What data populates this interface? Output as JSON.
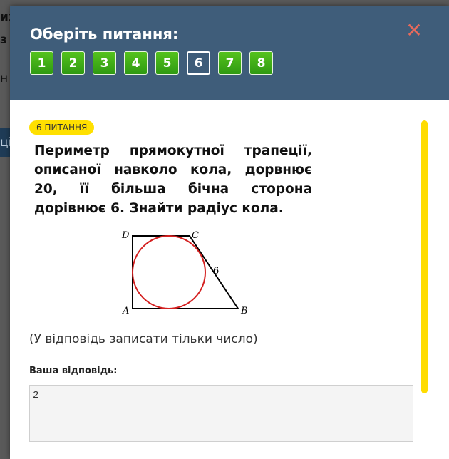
{
  "backdrop": {
    "line1": "их",
    "line2": "з",
    "line3": "н",
    "line4": "ці"
  },
  "modal": {
    "title": "Оберіть питання:",
    "close_label": "✕",
    "question_numbers": [
      "1",
      "2",
      "3",
      "4",
      "5",
      "6",
      "7",
      "8"
    ],
    "active_index": 5
  },
  "question": {
    "badge": "6 ПИТАННЯ",
    "text": "Периметр прямокутної трапеції, описаної навколо кола, дорвнює 20, її більша бічна сторона дорівнює 6. Знайти радіус кола.",
    "hint": "(У відповідь записати тільки число)"
  },
  "figure": {
    "labels": {
      "A": "A",
      "B": "B",
      "C": "C",
      "D": "D",
      "side": "6"
    },
    "colors": {
      "circle": "#d42020",
      "lines": "#000000"
    }
  },
  "answer": {
    "label": "Ваша відповідь:",
    "value": "2"
  },
  "colors": {
    "header": "#3f5d7a",
    "nav_button": "#3ea617",
    "badge": "#ffe000",
    "close": "#e66a5c",
    "scroll_indicator": "#ffdc00"
  }
}
